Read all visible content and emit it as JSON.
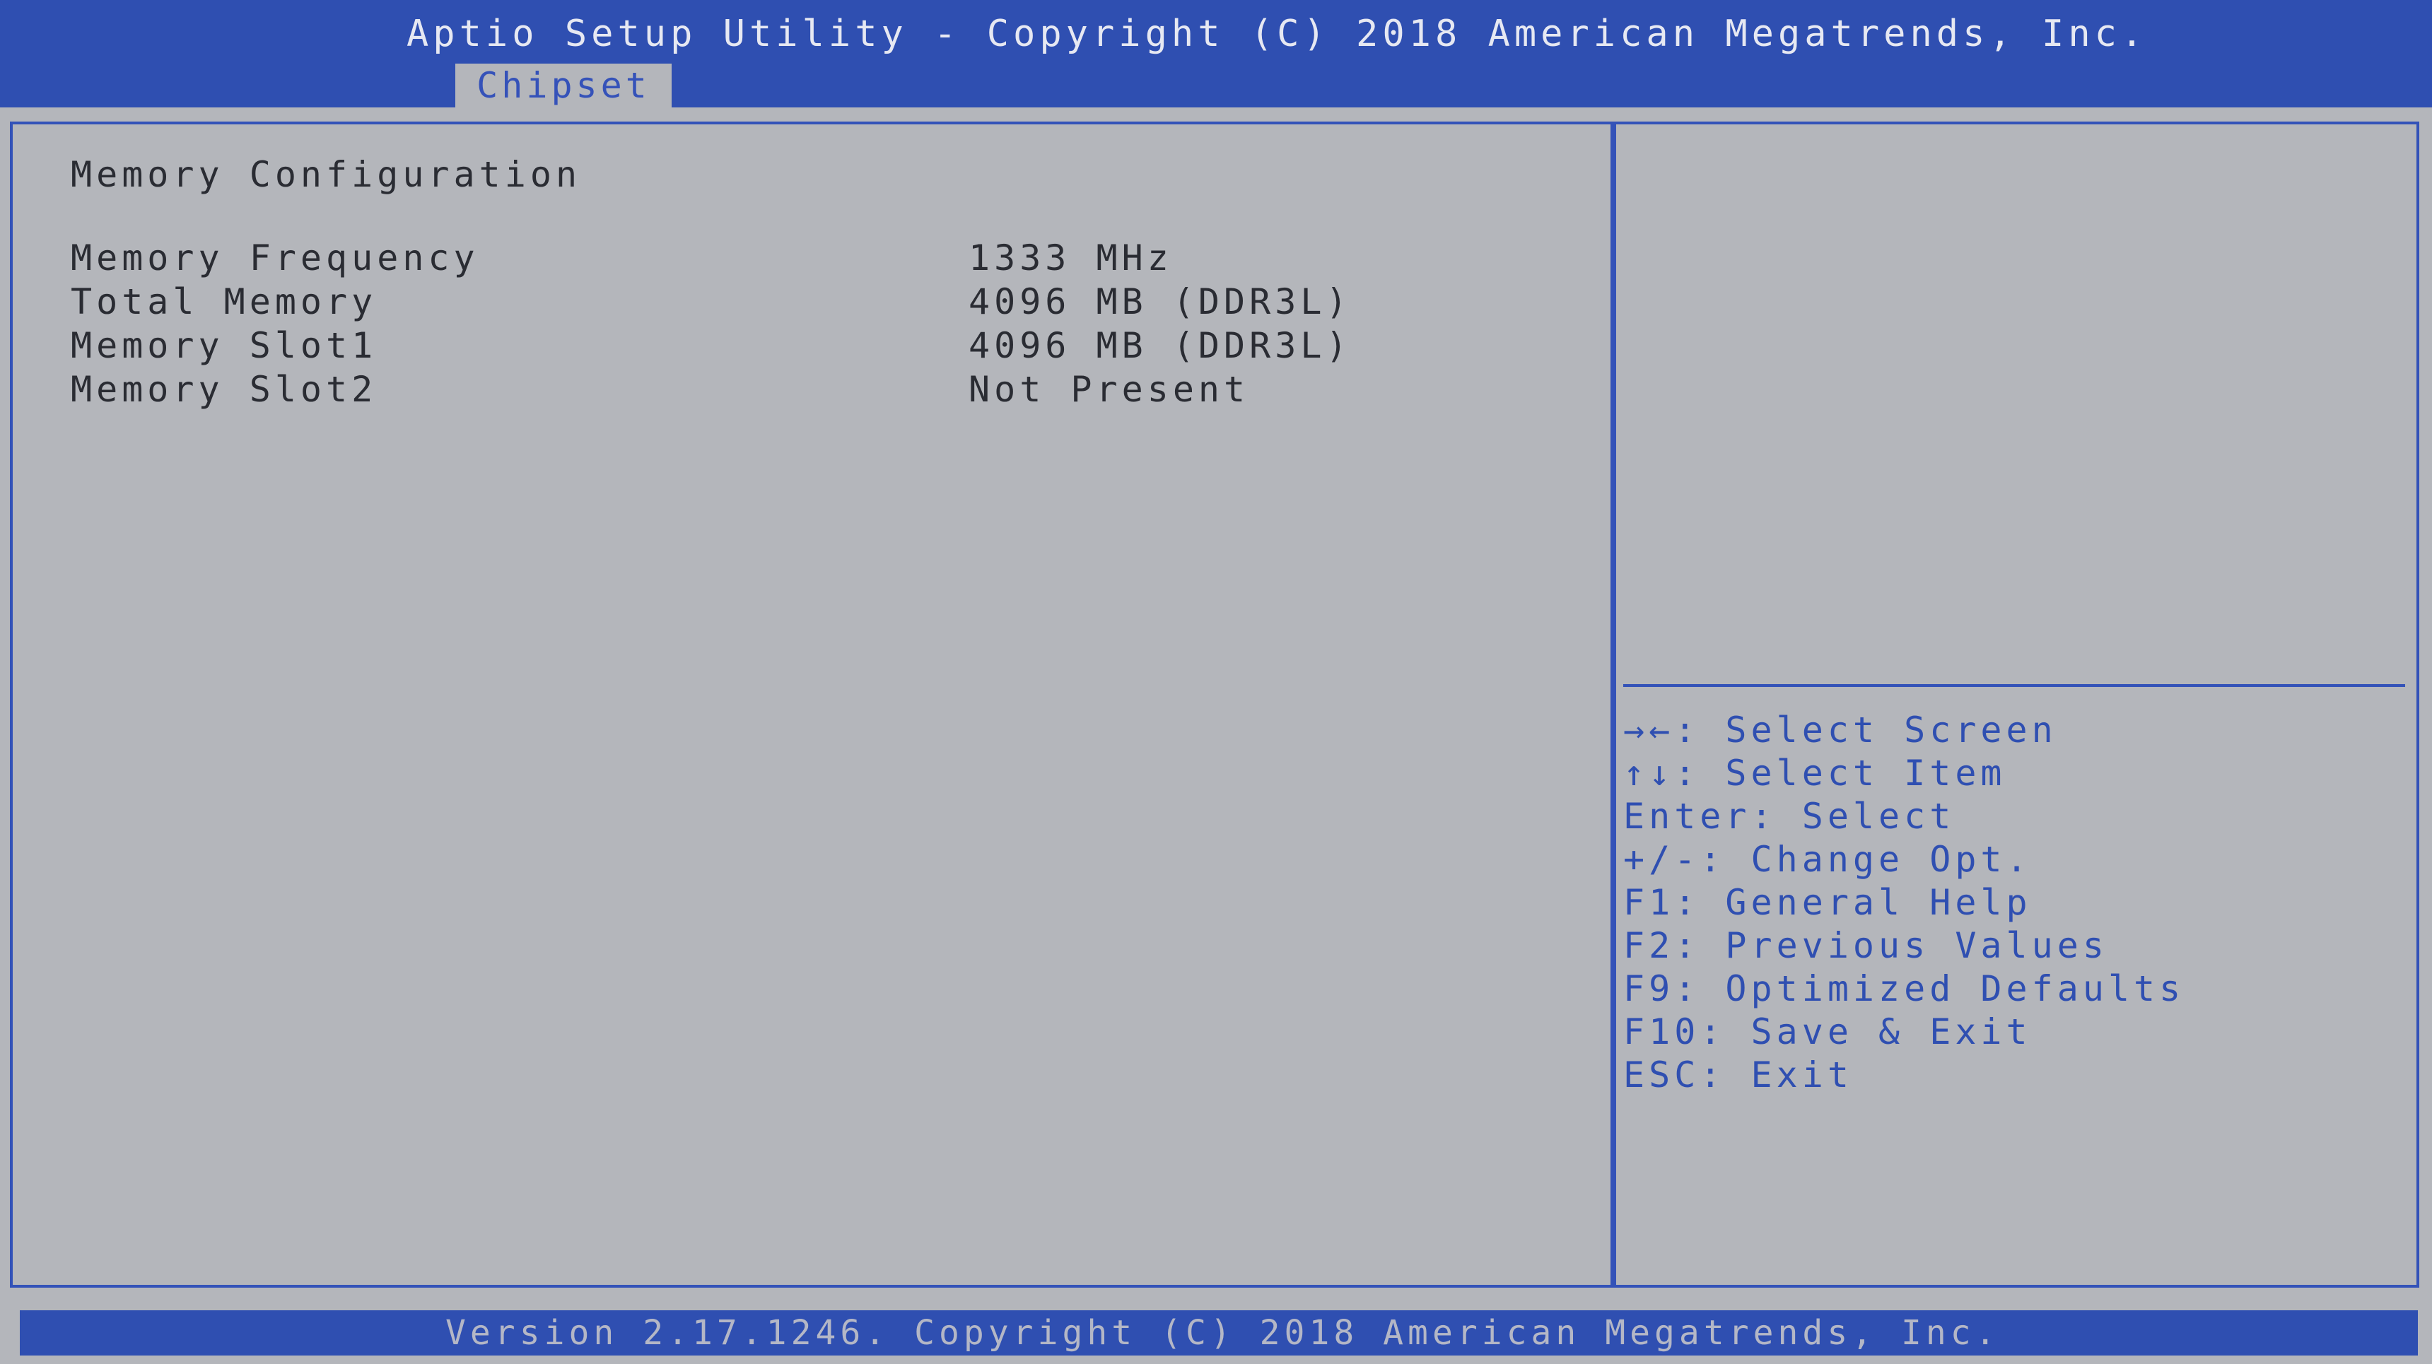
{
  "title_bar": {
    "title": "Aptio Setup Utility - Copyright (C) 2018 American Megatrends, Inc.",
    "active_tab": "Chipset"
  },
  "main": {
    "section_title": "Memory Configuration",
    "rows": [
      {
        "label": "Memory Frequency",
        "value": "1333 MHz"
      },
      {
        "label": "Total Memory",
        "value": "4096 MB (DDR3L)"
      },
      {
        "label": "Memory Slot1",
        "value": "4096 MB (DDR3L)"
      },
      {
        "label": "Memory Slot2",
        "value": "Not Present"
      }
    ]
  },
  "help": {
    "lines": [
      "→←: Select Screen",
      "↑↓: Select Item",
      "Enter: Select",
      "+/-: Change Opt.",
      "F1: General Help",
      "F2: Previous Values",
      "F9: Optimized Defaults",
      "F10: Save & Exit",
      "ESC: Exit"
    ]
  },
  "footer": {
    "version_text": "Version 2.17.1246. Copyright (C) 2018 American Megatrends, Inc."
  },
  "colors": {
    "background": "#b4b6bb",
    "accent_blue": "#2f4fb1",
    "text_dark": "#2a2c33"
  }
}
